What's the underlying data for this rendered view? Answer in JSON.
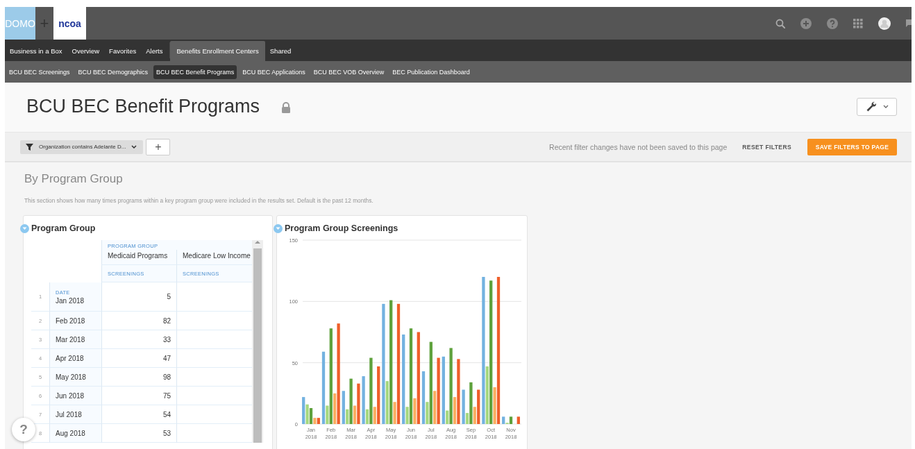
{
  "header": {
    "logo": "DOMO",
    "plus": "+",
    "partner_logo": "ncoa"
  },
  "nav": {
    "items": [
      {
        "label": "Business in a Box",
        "selected": false
      },
      {
        "label": "Overview",
        "selected": false
      },
      {
        "label": "Favorites",
        "selected": false
      },
      {
        "label": "Alerts",
        "selected": false
      },
      {
        "label": "Benefits Enrollment Centers",
        "selected": true
      },
      {
        "label": "Shared",
        "selected": false
      }
    ]
  },
  "subnav": {
    "items": [
      {
        "label": "BCU BEC Screenings",
        "selected": false
      },
      {
        "label": "BCU BEC Demographics",
        "selected": false
      },
      {
        "label": "BCU BEC Benefit Programs",
        "selected": true
      },
      {
        "label": "BCU BEC Applications",
        "selected": false
      },
      {
        "label": "BCU BEC VOB Overview",
        "selected": false
      },
      {
        "label": "BEC Publication Dashboard",
        "selected": false
      }
    ]
  },
  "page": {
    "title": "BCU BEC Benefit Programs",
    "locked": true
  },
  "filters": {
    "pill": "Organization contains Adelante D...",
    "add": "+",
    "notice": "Recent filter changes have not been saved to this page",
    "reset": "RESET FILTERS",
    "save": "SAVE FILTERS TO PAGE"
  },
  "section": {
    "title": "By Program Group",
    "description": "This section shows how many times programs within a key program group were included in the results set. Default is the past 12 months."
  },
  "table_card": {
    "title": "Program Group",
    "group_label": "PROGRAM GROUP",
    "row_header": "DATE",
    "columns": [
      {
        "name": "Medicaid Programs",
        "measure": "SCREENINGS"
      },
      {
        "name": "Medicare Low Income",
        "measure": "SCREENINGS"
      }
    ],
    "rows": [
      {
        "number": "1",
        "date": "Jan 2018",
        "values": [
          "5"
        ]
      },
      {
        "number": "2",
        "date": "Feb 2018",
        "values": [
          "82"
        ]
      },
      {
        "number": "3",
        "date": "Mar 2018",
        "values": [
          "33"
        ]
      },
      {
        "number": "4",
        "date": "Apr 2018",
        "values": [
          "47"
        ]
      },
      {
        "number": "5",
        "date": "May 2018",
        "values": [
          "98"
        ]
      },
      {
        "number": "6",
        "date": "Jun 2018",
        "values": [
          "75"
        ]
      },
      {
        "number": "7",
        "date": "Jul 2018",
        "values": [
          "54"
        ]
      },
      {
        "number": "8",
        "date": "Aug 2018",
        "values": [
          "53"
        ]
      }
    ]
  },
  "chart_card": {
    "title": "Program Group Screenings",
    "chart_data": {
      "type": "bar",
      "categories": [
        "Jan 2018",
        "Feb 2018",
        "Mar 2018",
        "Apr 2018",
        "May 2018",
        "Jun 2018",
        "Jul 2018",
        "Aug 2018",
        "Sep 2018",
        "Oct 2018",
        "Nov 2018"
      ],
      "ylim": [
        0,
        150
      ],
      "yticks": [
        0,
        50,
        100,
        150
      ],
      "series": [
        {
          "color": "#73b2e0",
          "values": [
            22,
            59,
            27,
            39,
            98,
            73,
            43,
            55,
            28,
            120,
            6
          ]
        },
        {
          "color": "#a6d87f",
          "values": [
            16,
            15,
            12,
            12,
            35,
            14,
            18,
            11,
            9,
            47,
            1
          ]
        },
        {
          "color": "#5ea13c",
          "values": [
            13,
            78,
            37,
            54,
            101,
            78,
            67,
            62,
            34,
            117,
            6
          ]
        },
        {
          "color": "#fbae62",
          "values": [
            5,
            25,
            15,
            14,
            18,
            21,
            27,
            22,
            14,
            30,
            null
          ]
        },
        {
          "color": "#ef5f2a",
          "values": [
            5,
            82,
            33,
            47,
            98,
            75,
            54,
            53,
            28,
            120,
            6
          ]
        }
      ]
    }
  },
  "help": "?"
}
